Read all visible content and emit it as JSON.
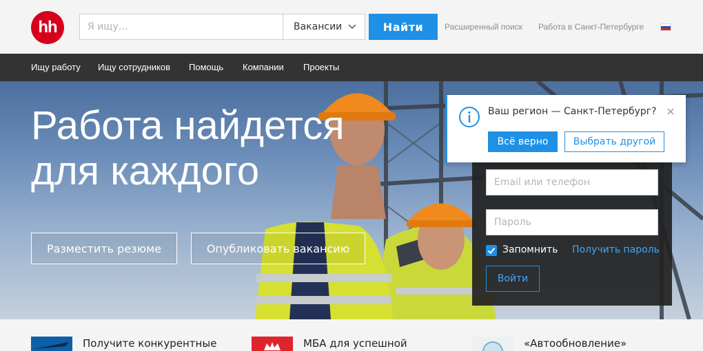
{
  "header": {
    "logo_text": "hh",
    "search": {
      "placeholder": "Я ищу…",
      "value": ""
    },
    "search_type": {
      "selected": "Вакансии"
    },
    "find_label": "Найти",
    "advanced_search": "Расширенный поиск",
    "city_jobs": "Работа в Санкт-Петербурге",
    "language_flag_icon": "russian-flag-icon"
  },
  "nav": {
    "items": [
      {
        "label": "Ищу работу"
      },
      {
        "label": "Ищу сотрудников"
      },
      {
        "label": "Помощь"
      },
      {
        "label": "Компании"
      },
      {
        "label": "Проекты"
      }
    ]
  },
  "hero": {
    "title_line1": "Работа найдется",
    "title_line2": "для каждого",
    "post_resume": "Разместить резюме",
    "post_vacancy": "Опубликовать вакансию"
  },
  "login": {
    "email_placeholder": "Email или телефон",
    "password_placeholder": "Пароль",
    "remember_label": "Запомнить",
    "remember_checked": true,
    "get_password": "Получить пароль",
    "login_label": "Войти"
  },
  "region_popup": {
    "question": "Ваш регион — Санкт-Петербург?",
    "confirm_label": "Всё верно",
    "choose_other_label": "Выбрать другой"
  },
  "promo": {
    "items": [
      {
        "text": "Получите конкурентные"
      },
      {
        "text": "МБА для успешной"
      },
      {
        "text": "«Автообновление»"
      }
    ]
  },
  "colors": {
    "brand_red": "#d6001c",
    "accent_blue": "#1e90e6",
    "nav_bg": "#333333",
    "header_bg": "#f4f4f4"
  }
}
